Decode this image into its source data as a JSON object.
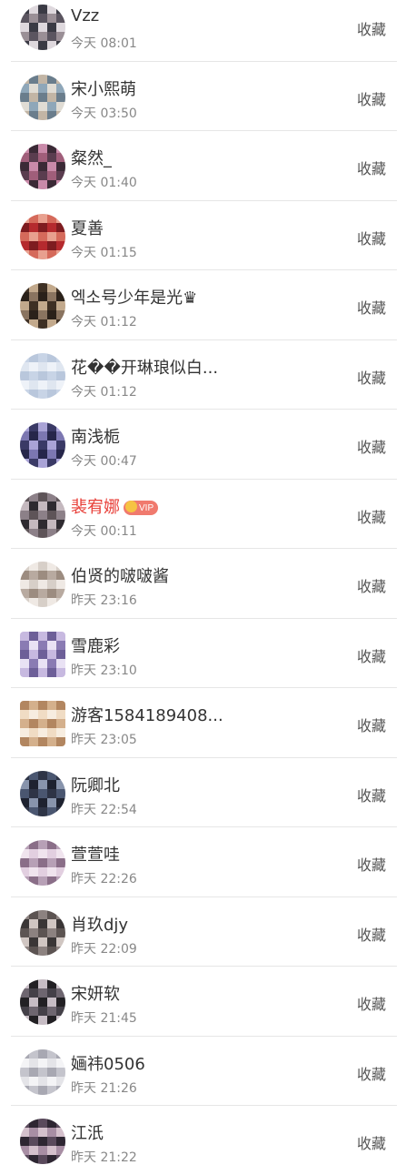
{
  "follow_list": {
    "action_label": "收藏",
    "items": [
      {
        "name": "Vzz",
        "time": "今天 08:01",
        "vip": false,
        "vip_text": "",
        "avatar_colors": [
          "#3a3a44",
          "#9a8f96",
          "#ded8dd",
          "#5b5560"
        ],
        "avatar_shape": "circle"
      },
      {
        "name": "宋小熙萌",
        "time": "今天 03:50",
        "vip": false,
        "vip_text": "",
        "avatar_colors": [
          "#8fa7b9",
          "#c2b5a5",
          "#e0dcd4",
          "#6a7d8c"
        ],
        "avatar_shape": "circle"
      },
      {
        "name": "粲然_",
        "time": "今天 01:40",
        "vip": false,
        "vip_text": "",
        "avatar_colors": [
          "#3b2a36",
          "#a05e7a",
          "#c98aa9",
          "#5a3d4f"
        ],
        "avatar_shape": "circle"
      },
      {
        "name": "夏善",
        "time": "今天 01:15",
        "vip": false,
        "vip_text": "",
        "avatar_colors": [
          "#b52a2e",
          "#d56a5b",
          "#7e1c20",
          "#e8a08f"
        ],
        "avatar_shape": "circle"
      },
      {
        "name": "엑소号少年是光♛",
        "time": "今天 01:12",
        "vip": false,
        "vip_text": "",
        "avatar_colors": [
          "#3e3024",
          "#8a7460",
          "#c2a98c",
          "#2a211a"
        ],
        "avatar_shape": "circle"
      },
      {
        "name": "花��开琳琅似白...",
        "time": "今天 01:12",
        "vip": false,
        "vip_text": "",
        "avatar_colors": [
          "#dfe6f0",
          "#c8d4e6",
          "#eef2f8",
          "#b9c7dc"
        ],
        "avatar_shape": "circle"
      },
      {
        "name": "南浅栀",
        "time": "今天 00:47",
        "vip": false,
        "vip_text": "",
        "avatar_colors": [
          "#3a3a66",
          "#7c77b1",
          "#a9a3d6",
          "#26264a"
        ],
        "avatar_shape": "circle"
      },
      {
        "name": "裴宥娜",
        "time": "今天 00:11",
        "vip": true,
        "vip_text": "VIP",
        "avatar_colors": [
          "#2e2a30",
          "#8c8088",
          "#c4b8be",
          "#5e5458"
        ],
        "avatar_shape": "circle"
      },
      {
        "name": "伯贤的啵啵酱",
        "time": "昨天 23:16",
        "vip": false,
        "vip_text": "",
        "avatar_colors": [
          "#d7cfc8",
          "#b8aaa0",
          "#efe9e4",
          "#9c8c80"
        ],
        "avatar_shape": "circle"
      },
      {
        "name": "雪鹿彩",
        "time": "昨天 23:10",
        "vip": false,
        "vip_text": "",
        "avatar_colors": [
          "#8a7bb3",
          "#c7b9e0",
          "#e9e2f4",
          "#6d5f98"
        ],
        "avatar_shape": "square"
      },
      {
        "name": "游客1584189408...",
        "time": "昨天 23:05",
        "vip": false,
        "vip_text": "",
        "avatar_colors": [
          "#d4b08c",
          "#f0dcc4",
          "#b28660",
          "#f7ede0"
        ],
        "avatar_shape": "square"
      },
      {
        "name": "阮卿北",
        "time": "昨天 22:54",
        "vip": false,
        "vip_text": "",
        "avatar_colors": [
          "#1e2230",
          "#4a5670",
          "#8894ac",
          "#2e3446"
        ],
        "avatar_shape": "circle"
      },
      {
        "name": "萱萱哇",
        "time": "昨天 22:26",
        "vip": false,
        "vip_text": "",
        "avatar_colors": [
          "#b7a0b6",
          "#e2cfe0",
          "#8a6e88",
          "#f0e4ee"
        ],
        "avatar_shape": "circle"
      },
      {
        "name": "肖玖djy",
        "time": "昨天 22:09",
        "vip": false,
        "vip_text": "",
        "avatar_colors": [
          "#3a3636",
          "#8c8280",
          "#d0c6c2",
          "#5c5452"
        ],
        "avatar_shape": "circle"
      },
      {
        "name": "宋妍软",
        "time": "昨天 21:45",
        "vip": false,
        "vip_text": "",
        "avatar_colors": [
          "#222024",
          "#6e6670",
          "#c6bcc4",
          "#444048"
        ],
        "avatar_shape": "circle"
      },
      {
        "name": "婳祎0506",
        "time": "昨天 21:26",
        "vip": false,
        "vip_text": "",
        "avatar_colors": [
          "#e4e4e8",
          "#c4c4cc",
          "#f4f4f6",
          "#a8a8b2"
        ],
        "avatar_shape": "circle"
      },
      {
        "name": "江汦",
        "time": "昨天 21:22",
        "vip": false,
        "vip_text": "",
        "avatar_colors": [
          "#5a4a5c",
          "#a88ea4",
          "#2e2632",
          "#d4c0cc"
        ],
        "avatar_shape": "circle"
      }
    ]
  }
}
